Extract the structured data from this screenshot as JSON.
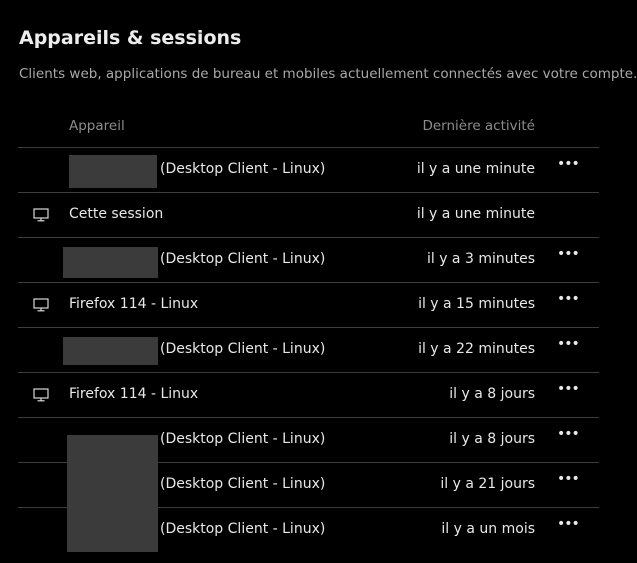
{
  "header": {
    "title": "Appareils & sessions",
    "subtitle": "Clients web, applications de bureau et mobiles actuellement connectés avec votre compte."
  },
  "table": {
    "columns": {
      "device": "Appareil",
      "activity": "Dernière activité"
    },
    "rows": [
      {
        "name": "",
        "client": "(Desktop Client - Linux)",
        "activity": "il y a une minute",
        "icon": "",
        "menu": "•••"
      },
      {
        "name": "Cette session",
        "client": "",
        "activity": "il y a une minute",
        "icon": "monitor-icon",
        "menu": ""
      },
      {
        "name": "",
        "client": "(Desktop Client - Linux)",
        "activity": "il y a 3 minutes",
        "icon": "",
        "menu": "•••"
      },
      {
        "name": "Firefox 114 - Linux",
        "client": "",
        "activity": "il y a 15 minutes",
        "icon": "monitor-icon",
        "menu": "•••"
      },
      {
        "name": "",
        "client": "(Desktop Client - Linux)",
        "activity": "il y a 22 minutes",
        "icon": "",
        "menu": "•••"
      },
      {
        "name": "Firefox 114 - Linux",
        "client": "",
        "activity": "il y a 8 jours",
        "icon": "monitor-icon",
        "menu": "•••"
      },
      {
        "name": "",
        "client": "(Desktop Client - Linux)",
        "activity": "il y a 8 jours",
        "icon": "",
        "menu": "•••"
      },
      {
        "name": "",
        "client": "(Desktop Client - Linux)",
        "activity": "il y a 21 jours",
        "icon": "",
        "menu": "•••"
      },
      {
        "name": "",
        "client": "(Desktop Client - Linux)",
        "activity": "il y a un mois",
        "icon": "",
        "menu": "•••"
      }
    ]
  },
  "colors": {
    "background": "#000000",
    "text": "#e8e8e8",
    "muted": "#a9a9a9",
    "divider": "#3c3c3c",
    "redaction": "#3b3b3b"
  }
}
